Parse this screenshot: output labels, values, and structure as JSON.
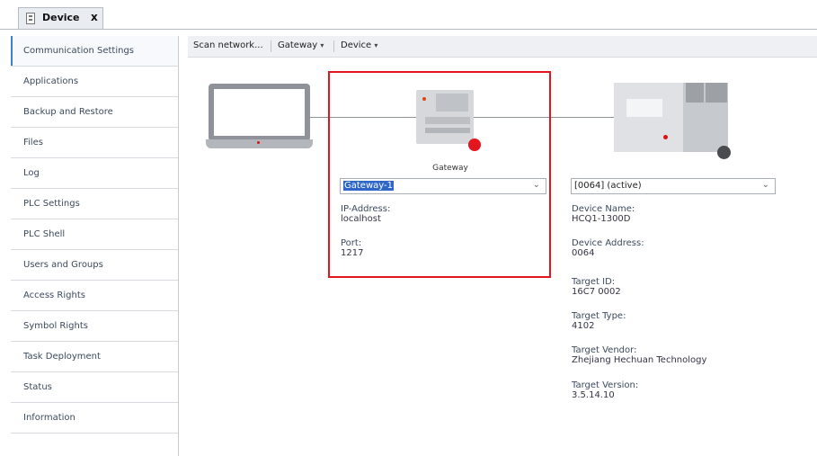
{
  "tab": {
    "title": "Device",
    "close": "x"
  },
  "sidebar": {
    "items": [
      {
        "label": "Communication Settings"
      },
      {
        "label": "Applications"
      },
      {
        "label": "Backup and Restore"
      },
      {
        "label": "Files"
      },
      {
        "label": "Log"
      },
      {
        "label": "PLC Settings"
      },
      {
        "label": "PLC Shell"
      },
      {
        "label": "Users and Groups"
      },
      {
        "label": "Access Rights"
      },
      {
        "label": "Symbol Rights"
      },
      {
        "label": "Task Deployment"
      },
      {
        "label": "Status"
      },
      {
        "label": "Information"
      }
    ]
  },
  "toolbar": {
    "scan": "Scan network...",
    "gateway": "Gateway",
    "device": "Device",
    "caret": "▾"
  },
  "gateway": {
    "label": "Gateway",
    "combo_value": "Gateway-1",
    "ip_label": "IP-Address:",
    "ip_value": "localhost",
    "port_label": "Port:",
    "port_value": "1217"
  },
  "device": {
    "combo_value": "[0064] (active)",
    "name_label": "Device Name:",
    "name_value": "HCQ1-1300D",
    "address_label": "Device Address:",
    "address_value": "0064",
    "target_id_label": "Target ID:",
    "target_id_value": "16C7 0002",
    "target_type_label": "Target Type:",
    "target_type_value": "4102",
    "target_vendor_label": "Target Vendor:",
    "target_vendor_value": "Zhejiang Hechuan Technology",
    "target_version_label": "Target Version:",
    "target_version_value": "3.5.14.10"
  },
  "icons": {
    "chevron": "⌄"
  },
  "colors": {
    "highlight": "#e0161c",
    "gateway_status": "#e3151f",
    "device_status": "#4a4b4e",
    "accent": "#3b82c4"
  }
}
